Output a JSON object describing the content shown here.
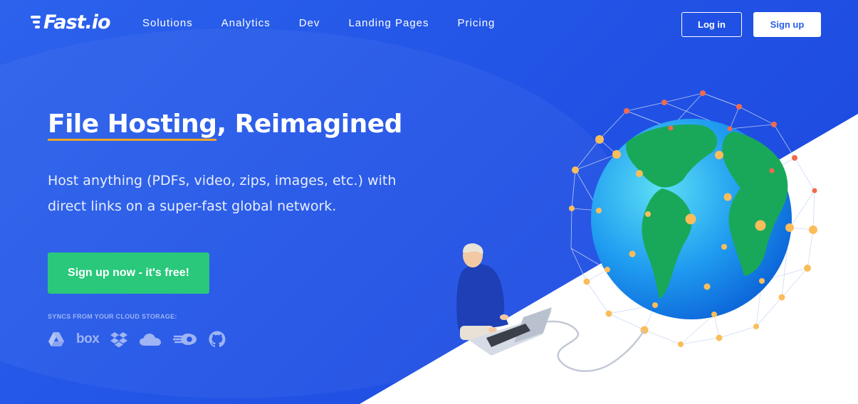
{
  "brand": {
    "name": "Fast.io"
  },
  "nav": {
    "links": [
      "Solutions",
      "Analytics",
      "Dev",
      "Landing Pages",
      "Pricing"
    ],
    "login_label": "Log in",
    "signup_label": "Sign up"
  },
  "hero": {
    "title_highlight": "File Hosting",
    "title_rest": ", Reimagined",
    "subtitle": "Host anything (PDFs, video, zips, images, etc.) with direct links on a super-fast global network.",
    "cta_label": "Sign up now - it's free!"
  },
  "sync": {
    "label": "SYNCS FROM YOUR CLOUD STORAGE:",
    "providers": [
      {
        "icon": "google-drive-icon"
      },
      {
        "icon": "box-icon",
        "text": "box"
      },
      {
        "icon": "dropbox-icon"
      },
      {
        "icon": "onedrive-icon"
      },
      {
        "icon": "mediafire-icon"
      },
      {
        "icon": "github-icon"
      }
    ]
  },
  "colors": {
    "background": "#2458e8",
    "cta": "#29c87a",
    "accent_underline": "#f5a623",
    "muted_icon": "#9eb4f3"
  }
}
